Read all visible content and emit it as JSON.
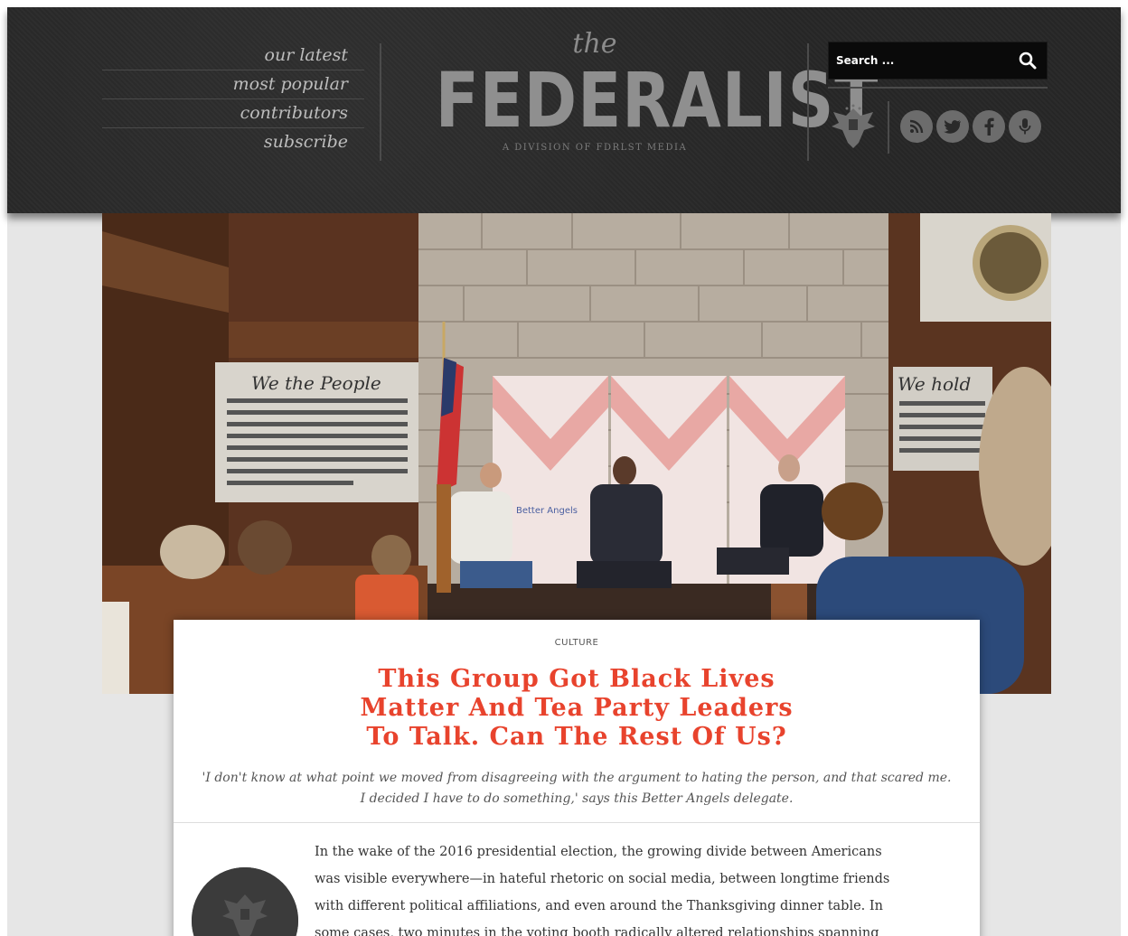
{
  "nav": {
    "items": [
      {
        "label": "our latest"
      },
      {
        "label": "most popular"
      },
      {
        "label": "contributors"
      },
      {
        "label": "subscribe"
      }
    ]
  },
  "logo": {
    "the": "the",
    "name": "FEDERALIST",
    "tagline": "A DIVISION OF FDRLST MEDIA"
  },
  "search": {
    "placeholder": "Search ..."
  },
  "social": {
    "icons": [
      "eagle-logo-icon",
      "rss-icon",
      "twitter-icon",
      "facebook-icon",
      "podcast-microphone-icon"
    ]
  },
  "hero": {
    "banner_left_heading": "We the People",
    "banner_right_heading": "We hold",
    "backdrop_label": "Better Angels"
  },
  "article": {
    "kicker": "CULTURE",
    "title_lines": [
      "This Group Got Black Lives",
      "Matter And Tea Party Leaders",
      "To Talk. Can The Rest Of Us?"
    ],
    "subtitle": "'I don't know at what point we moved from disagreeing with the argument to hating the person, and that scared me. I decided I have to do something,' says this Better Angels delegate.",
    "body_lines": [
      "In the wake of the 2016 presidential election, the growing divide between Americans",
      "was visible everywhere—in hateful rhetoric on social media, between longtime friends",
      "with different political affiliations, and even around the Thanksgiving dinner table. In",
      "some cases, two minutes in the voting booth radically altered relationships spanning"
    ]
  },
  "colors": {
    "header_bg": "#2a2a2a",
    "title_red": "#e8432d",
    "page_bg": "#e6e6e6"
  }
}
